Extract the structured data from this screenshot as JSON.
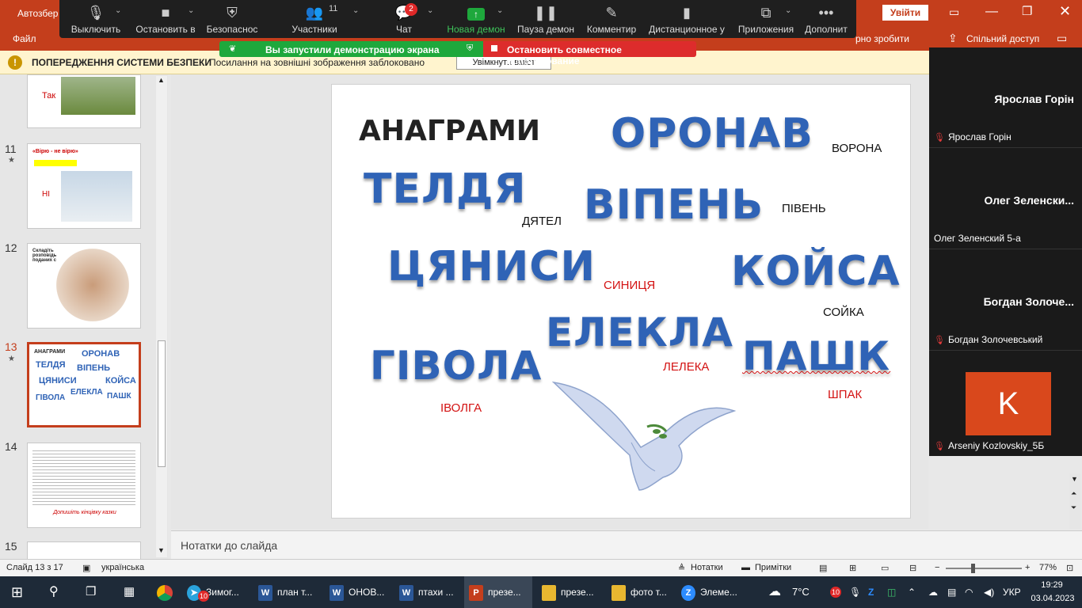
{
  "ppt": {
    "title_left": "Автозбер",
    "login_button": "Увійти",
    "menu_file": "Файл",
    "menu_tail": "рно зробити",
    "share_button": "Спільний доступ",
    "warning_title": "ПОПЕРЕДЖЕННЯ СИСТЕМИ БЕЗПЕКИ",
    "warning_text": "Посилання на зовнішні зображення заблоковано",
    "enable_content": "Увімкнути вміст"
  },
  "zoom": {
    "buttons": [
      {
        "label": "Выключить",
        "icon": "microphone-icon"
      },
      {
        "label": "Остановить в",
        "icon": "video-camera-icon"
      },
      {
        "label": "Безопаснос",
        "icon": "shield-icon"
      },
      {
        "label": "Участники",
        "icon": "participants-icon",
        "count": "11"
      },
      {
        "label": "Чат",
        "icon": "chat-icon",
        "badge": "2"
      },
      {
        "label": "Новая демон",
        "icon": "share-screen-icon"
      },
      {
        "label": "Пауза демон",
        "icon": "pause-icon"
      },
      {
        "label": "Комментир",
        "icon": "pen-icon"
      },
      {
        "label": "Дистанционное у",
        "icon": "mouse-icon"
      },
      {
        "label": "Приложения",
        "icon": "apps-icon"
      },
      {
        "label": "Дополнит",
        "icon": "more-icon"
      }
    ],
    "share_status": "Вы запустили демонстрацию экрана",
    "stop_share": "Остановить совместное использование",
    "accent_green": "#1ea83c",
    "accent_red": "#dd2c2c"
  },
  "thumbs": [
    {
      "num": "",
      "text": "Так"
    },
    {
      "num": "11",
      "text": "НІ",
      "title": "«Вірю - не вірю»"
    },
    {
      "num": "12",
      "text": "Складіть розповідь з поданих слів"
    },
    {
      "num": "13",
      "text": "АНАГРАМИ"
    },
    {
      "num": "14",
      "text": "Допишіть кінцівку казки"
    },
    {
      "num": "15",
      "text": ""
    }
  ],
  "slide": {
    "title": "АНАГРАМИ",
    "words": [
      {
        "anagram": "ОРОНАВ",
        "answer": "ВОРОНА"
      },
      {
        "anagram": "ТЕЛДЯ",
        "answer": "ДЯТЕЛ"
      },
      {
        "anagram": "ВІПЕНЬ",
        "answer": "ПІВЕНЬ"
      },
      {
        "anagram": "ЦЯНИСИ",
        "answer": "СИНИЦЯ"
      },
      {
        "anagram": "КОЙСА",
        "answer": "СОЙКА"
      },
      {
        "anagram": "ЕЛЕКЛА",
        "answer": "ЛЕЛЕКА"
      },
      {
        "anagram": "ГІВОЛА",
        "answer": "ІВОЛГА"
      },
      {
        "anagram": "ПАШК",
        "answer": "ШПАК"
      }
    ]
  },
  "notes_placeholder": "Нотатки до слайда",
  "participants": [
    {
      "big": "Ярослав Горін",
      "small": "Ярослав Горін"
    },
    {
      "big": "Олег  Зеленски...",
      "small": "Олег Зеленский 5-а"
    },
    {
      "big": "Богдан  Золоче...",
      "small": "Богдан Золочевський"
    },
    {
      "big": "K",
      "small": "Arseniy Kozlovskiy_5Б",
      "avatar_color": "#d9481c"
    }
  ],
  "status": {
    "slide": "Слайд 13 з 17",
    "language": "українська",
    "notes": "Нотатки",
    "comments": "Примітки",
    "zoom": "77%"
  },
  "taskbar": {
    "items": [
      {
        "label": "Зимог...",
        "badge": "10"
      },
      {
        "label": "план т..."
      },
      {
        "label": "ОНОВ..."
      },
      {
        "label": "птахи ..."
      },
      {
        "label": "презе..."
      },
      {
        "label": "презе..."
      },
      {
        "label": "фото т..."
      },
      {
        "label": "Элеме..."
      }
    ],
    "weather": "7°C",
    "tray_badge": "10",
    "lang": "УКР",
    "time": "19:29",
    "date": "03.04.2023"
  }
}
